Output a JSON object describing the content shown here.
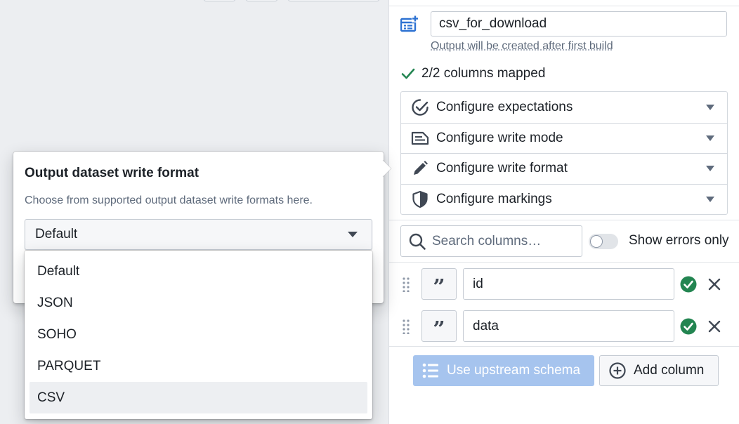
{
  "output": {
    "name_value": "csv_for_download",
    "hint": "Output will be created after first build",
    "mapped_status": "2/2 columns mapped"
  },
  "config_sections": [
    {
      "label": "Configure expectations",
      "icon": "expectations-icon"
    },
    {
      "label": "Configure write mode",
      "icon": "write-mode-icon"
    },
    {
      "label": "Configure write format",
      "icon": "pencil-icon"
    },
    {
      "label": "Configure markings",
      "icon": "shield-icon"
    }
  ],
  "columns_toolbar": {
    "search_placeholder": "Search columns…",
    "toggle_label": "Show errors only",
    "toggle_on": false
  },
  "columns": [
    {
      "name": "id",
      "type_icon": "quote-icon",
      "status": "valid"
    },
    {
      "name": "data",
      "type_icon": "quote-icon",
      "status": "valid"
    }
  ],
  "footer": {
    "upstream_label": "Use upstream schema",
    "add_label": "Add column"
  },
  "popover": {
    "title": "Output dataset write format",
    "description": "Choose from supported output dataset write formats here.",
    "selected": "Default",
    "options": [
      "Default",
      "JSON",
      "SOHO",
      "PARQUET",
      "CSV"
    ],
    "highlighted_option": "CSV"
  },
  "colors": {
    "accent_blue": "#2d72d2",
    "success_green": "#238551",
    "disabled_blue": "#a6c4ee"
  }
}
